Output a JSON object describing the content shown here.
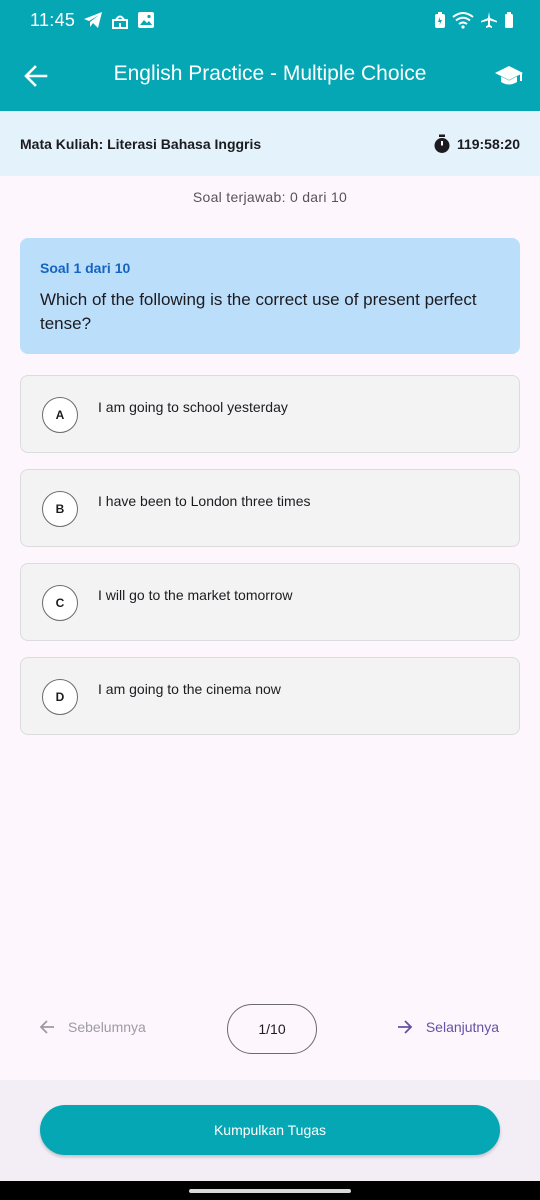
{
  "status_bar": {
    "time": "11:45"
  },
  "app_bar": {
    "title": "English Practice - Multiple Choice"
  },
  "course": {
    "label": "Mata Kuliah: Literasi Bahasa Inggris",
    "timer": "119:58:20"
  },
  "progress": {
    "answered_text": "Soal terjawab: 0 dari 10"
  },
  "question": {
    "number_label": "Soal 1 dari 10",
    "text": "Which of the following is the correct use of present perfect tense?"
  },
  "options": [
    {
      "letter": "A",
      "text": "I am going to school yesterday"
    },
    {
      "letter": "B",
      "text": "I have been to London three times"
    },
    {
      "letter": "C",
      "text": "I will go to the market tomorrow"
    },
    {
      "letter": "D",
      "text": "I am going to the cinema now"
    }
  ],
  "navigation": {
    "prev_label": "Sebelumnya",
    "page_indicator": "1/10",
    "next_label": "Selanjutnya"
  },
  "submit": {
    "label": "Kumpulkan Tugas"
  },
  "colors": {
    "primary": "#06a7b5",
    "question_bg": "#bbdefb",
    "accent_purple": "#6750a4"
  },
  "icons": [
    "arrow-back-icon",
    "graduation-cap-icon",
    "stopwatch-icon",
    "arrow-left-icon",
    "arrow-right-icon"
  ]
}
